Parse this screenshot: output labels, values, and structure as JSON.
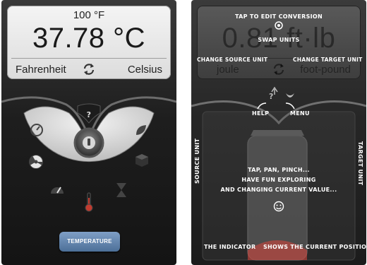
{
  "left": {
    "source_value": "100 °F",
    "result_value": "37.78 °C",
    "source_unit": "Fahrenheit",
    "target_unit": "Celsius",
    "help_symbol": "?",
    "category": "TEMPERATURE"
  },
  "right": {
    "result_value": "0.81 ft·lb",
    "source_unit": "joule",
    "target_unit": "foot-pound",
    "help_symbol": "?",
    "hints": {
      "tap_edit": "TAP TO EDIT CONVERSION",
      "swap": "SWAP UNITS",
      "change_source": "CHANGE SOURCE UNIT",
      "change_target": "CHANGE TARGET UNIT",
      "help": "HELP",
      "menu": "MENU",
      "source_unit_axis": "SOURCE UNIT",
      "target_unit_axis": "TARGET UNIT",
      "gesture_line1": "TAP, PAN, PINCH...",
      "gesture_line2": "HAVE FUN EXPLORING",
      "gesture_line3": "AND CHANGING CURRENT VALUE...",
      "indicator": "THE INDICATOR",
      "current_position": "SHOWS THE CURRENT POSITION"
    }
  }
}
